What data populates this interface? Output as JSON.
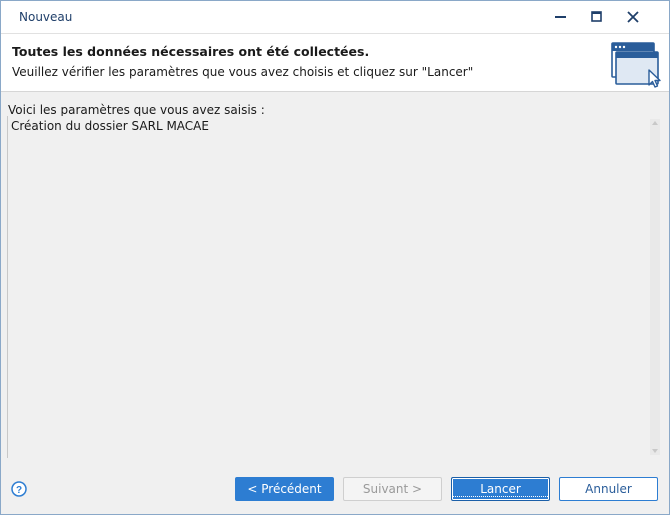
{
  "window": {
    "title": "Nouveau",
    "controls": [
      "minimize",
      "maximize",
      "close"
    ]
  },
  "header": {
    "title": "Toutes les données nécessaires ont été collectées.",
    "subtitle": "Veuillez vérifier les paramètres que vous avez choisis et cliquez sur \"Lancer\"",
    "icon": "window-cursor-icon"
  },
  "main": {
    "prompt": "Voici les paramètres que vous avez saisis :",
    "summary": "Création du dossier SARL MACAE"
  },
  "footer": {
    "help_icon": "help-icon",
    "prev_label": "< Précédent",
    "next_label": "Suivant >",
    "launch_label": "Lancer",
    "cancel_label": "Annuler"
  },
  "colors": {
    "accent": "#2d7dd2",
    "title_text": "#1f3f6a",
    "disabled_text": "#9a9a9a"
  }
}
